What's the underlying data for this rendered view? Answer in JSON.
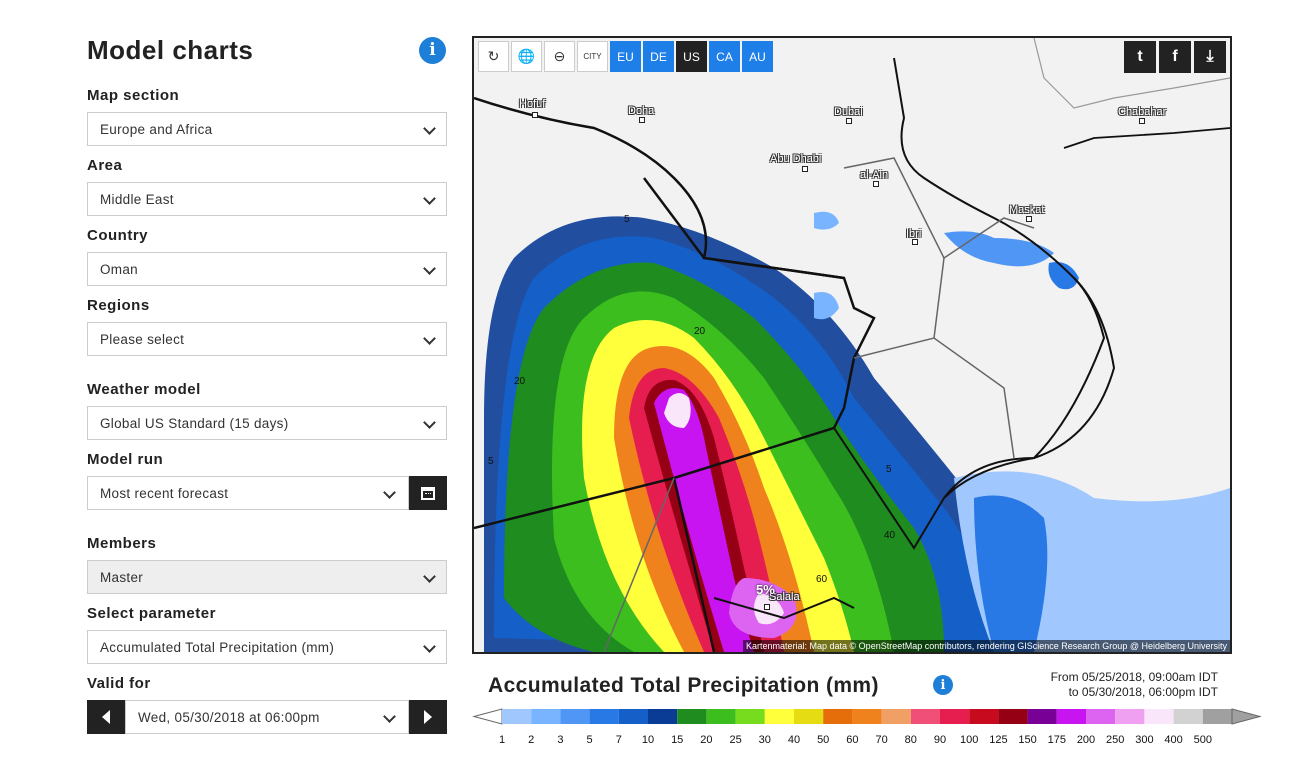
{
  "sidebar": {
    "title": "Model charts",
    "map_section": {
      "label": "Map section",
      "value": "Europe and Africa"
    },
    "area": {
      "label": "Area",
      "value": "Middle East"
    },
    "country": {
      "label": "Country",
      "value": "Oman"
    },
    "regions": {
      "label": "Regions",
      "value": "Please select"
    },
    "weather_model": {
      "label": "Weather model",
      "value": "Global US Standard (15 days)"
    },
    "model_run": {
      "label": "Model run",
      "value": "Most recent forecast"
    },
    "members": {
      "label": "Members",
      "value": "Master"
    },
    "parameter": {
      "label": "Select parameter",
      "value": "Accumulated Total Precipitation (mm)"
    },
    "valid_for": {
      "label": "Valid for",
      "value": "Wed, 05/30/2018 at 06:00pm"
    }
  },
  "map": {
    "toolbar": {
      "city_label": "CITY",
      "regions": [
        "EU",
        "DE",
        "US",
        "CA",
        "AU"
      ],
      "active_region": "US"
    },
    "cities": [
      {
        "name": "Hofuf"
      },
      {
        "name": "Doha"
      },
      {
        "name": "Dubai"
      },
      {
        "name": "Chabahar"
      },
      {
        "name": "Abu Dhabi"
      },
      {
        "name": "al-Ain"
      },
      {
        "name": "Maskat"
      },
      {
        "name": "Ibri"
      },
      {
        "name": "Salala"
      }
    ],
    "contour_labels": [
      "5",
      "20",
      "20",
      "5",
      "5",
      "40",
      "60",
      "5%"
    ],
    "attribution": "Kartenmaterial: Map data © OpenStreetMap contributors, rendering GIScience Research Group @ Heidelberg University"
  },
  "chart": {
    "title": "Accumulated Total Precipitation (mm)",
    "period_from": "From 05/25/2018, 09:00am IDT",
    "period_to": "to 05/30/2018, 06:00pm IDT"
  },
  "legend": {
    "values": [
      "1",
      "2",
      "3",
      "5",
      "7",
      "10",
      "15",
      "20",
      "25",
      "30",
      "40",
      "50",
      "60",
      "70",
      "80",
      "90",
      "100",
      "125",
      "150",
      "175",
      "200",
      "250",
      "300",
      "400",
      "500"
    ],
    "colors": [
      "#a0c8ff",
      "#78b4ff",
      "#5096f5",
      "#2878e6",
      "#1460c8",
      "#0a3c96",
      "#1e8c1e",
      "#3cbe1e",
      "#78dc1e",
      "#ffff3c",
      "#e6dc14",
      "#e66e0a",
      "#f0821e",
      "#f0a064",
      "#f05078",
      "#e61e50",
      "#c80a1e",
      "#960014",
      "#780096",
      "#c814f0",
      "#dc64f0",
      "#f0a0f0",
      "#fae6fa",
      "#d2d2d2",
      "#a0a0a0"
    ]
  }
}
